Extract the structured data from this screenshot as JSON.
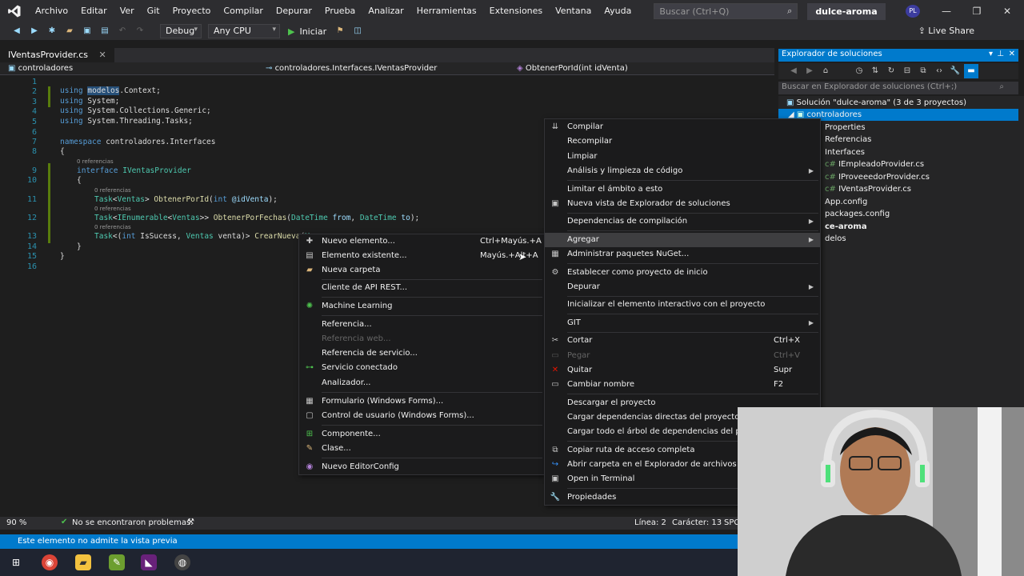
{
  "menu": {
    "items": [
      "Archivo",
      "Editar",
      "Ver",
      "Git",
      "Proyecto",
      "Compilar",
      "Depurar",
      "Prueba",
      "Analizar",
      "Herramientas",
      "Extensiones",
      "Ventana",
      "Ayuda"
    ],
    "search_placeholder": "Buscar (Ctrl+Q)",
    "solution_name": "dulce-aroma",
    "user_initials": "PL"
  },
  "toolbar": {
    "config": "Debug",
    "platform": "Any CPU",
    "run_label": "Iniciar",
    "live_share": "Live Share"
  },
  "editor": {
    "tab": "IVentasProvider.cs",
    "nav": {
      "project": "controladores",
      "type": "controladores.Interfaces.IVentasProvider",
      "member": "ObtenerPorId(int idVenta)"
    },
    "lens": "0 referencias",
    "line_numbers": [
      "1",
      "2",
      "3",
      "4",
      "5",
      "6",
      "7",
      "8",
      "9",
      "10",
      "11",
      "12",
      "13",
      "14",
      "15",
      "16"
    ],
    "zoom": "90 %",
    "problems": "No se encontraron problemas.",
    "line": "Línea: 2",
    "col": "Carácter: 13",
    "spc": "SPC"
  },
  "solution_explorer": {
    "title": "Explorador de soluciones",
    "search_placeholder": "Buscar en Explorador de soluciones (Ctrl+;)",
    "solution": "Solución \"dulce-aroma\" (3 de 3 proyectos)",
    "selected_project": "controladores",
    "items": [
      "Properties",
      "Referencias",
      "Interfaces",
      "IEmpleadoProvider.cs",
      "IProveeedorProvider.cs",
      "IVentasProvider.cs",
      "App.config",
      "packages.config",
      "ce-aroma",
      "delos"
    ]
  },
  "context_menu": {
    "items": [
      {
        "label": "Compilar",
        "shortcut": "",
        "submenu": false,
        "disabled": false
      },
      {
        "label": "Recompilar",
        "shortcut": "",
        "submenu": false,
        "disabled": false
      },
      {
        "label": "Limpiar",
        "shortcut": "",
        "submenu": false,
        "disabled": false
      },
      {
        "label": "Análisis y limpieza de código",
        "shortcut": "",
        "submenu": true,
        "disabled": false
      },
      {
        "label": "Limitar el ámbito a esto",
        "shortcut": "",
        "submenu": false,
        "disabled": false
      },
      {
        "label": "Nueva vista de Explorador de soluciones",
        "shortcut": "",
        "submenu": false,
        "disabled": false
      },
      {
        "label": "Dependencias de compilación",
        "shortcut": "",
        "submenu": true,
        "disabled": false
      },
      {
        "label": "Agregar",
        "shortcut": "",
        "submenu": true,
        "disabled": false
      },
      {
        "label": "Administrar paquetes NuGet...",
        "shortcut": "",
        "submenu": false,
        "disabled": false
      },
      {
        "label": "Establecer como proyecto de inicio",
        "shortcut": "",
        "submenu": false,
        "disabled": false
      },
      {
        "label": "Depurar",
        "shortcut": "",
        "submenu": true,
        "disabled": false
      },
      {
        "label": "Inicializar el elemento interactivo con el proyecto",
        "shortcut": "",
        "submenu": false,
        "disabled": false
      },
      {
        "label": "GIT",
        "shortcut": "",
        "submenu": true,
        "disabled": false
      },
      {
        "label": "Cortar",
        "shortcut": "Ctrl+X",
        "submenu": false,
        "disabled": false
      },
      {
        "label": "Pegar",
        "shortcut": "Ctrl+V",
        "submenu": false,
        "disabled": true
      },
      {
        "label": "Quitar",
        "shortcut": "Supr",
        "submenu": false,
        "disabled": false
      },
      {
        "label": "Cambiar nombre",
        "shortcut": "F2",
        "submenu": false,
        "disabled": false
      },
      {
        "label": "Descargar el proyecto",
        "shortcut": "",
        "submenu": false,
        "disabled": false
      },
      {
        "label": "Cargar dependencias directas del proyecto",
        "shortcut": "",
        "submenu": false,
        "disabled": false
      },
      {
        "label": "Cargar todo el árbol de dependencias del proye",
        "shortcut": "",
        "submenu": false,
        "disabled": false
      },
      {
        "label": "Copiar ruta de acceso completa",
        "shortcut": "",
        "submenu": false,
        "disabled": false
      },
      {
        "label": "Abrir carpeta en el Explorador de archivos",
        "shortcut": "",
        "submenu": false,
        "disabled": false
      },
      {
        "label": "Open in Terminal",
        "shortcut": "",
        "submenu": false,
        "disabled": false
      },
      {
        "label": "Propiedades",
        "shortcut": "",
        "submenu": false,
        "disabled": false
      }
    ]
  },
  "submenu": {
    "items": [
      {
        "label": "Nuevo elemento...",
        "shortcut": "Ctrl+Mayús.+A",
        "disabled": false
      },
      {
        "label": "Elemento existente...",
        "shortcut": "Mayús.+Alt+A",
        "disabled": false
      },
      {
        "label": "Nueva carpeta",
        "shortcut": "",
        "disabled": false
      },
      {
        "label": "Cliente de API REST...",
        "shortcut": "",
        "disabled": false
      },
      {
        "label": "Machine Learning",
        "shortcut": "",
        "disabled": false
      },
      {
        "label": "Referencia...",
        "shortcut": "",
        "disabled": false
      },
      {
        "label": "Referencia web...",
        "shortcut": "",
        "disabled": true
      },
      {
        "label": "Referencia de servicio...",
        "shortcut": "",
        "disabled": false
      },
      {
        "label": "Servicio conectado",
        "shortcut": "",
        "disabled": false
      },
      {
        "label": "Analizador...",
        "shortcut": "",
        "disabled": false
      },
      {
        "label": "Formulario (Windows Forms)...",
        "shortcut": "",
        "disabled": false
      },
      {
        "label": "Control de usuario (Windows Forms)...",
        "shortcut": "",
        "disabled": false
      },
      {
        "label": "Componente...",
        "shortcut": "",
        "disabled": false
      },
      {
        "label": "Clase...",
        "shortcut": "",
        "disabled": false
      },
      {
        "label": "Nuevo EditorConfig",
        "shortcut": "",
        "disabled": false
      }
    ]
  },
  "status": {
    "message": "Este elemento no admite la vista previa"
  },
  "colors": {
    "accent": "#007acc",
    "background": "#1e1e1e",
    "menu_bg": "#1b1b1c"
  }
}
